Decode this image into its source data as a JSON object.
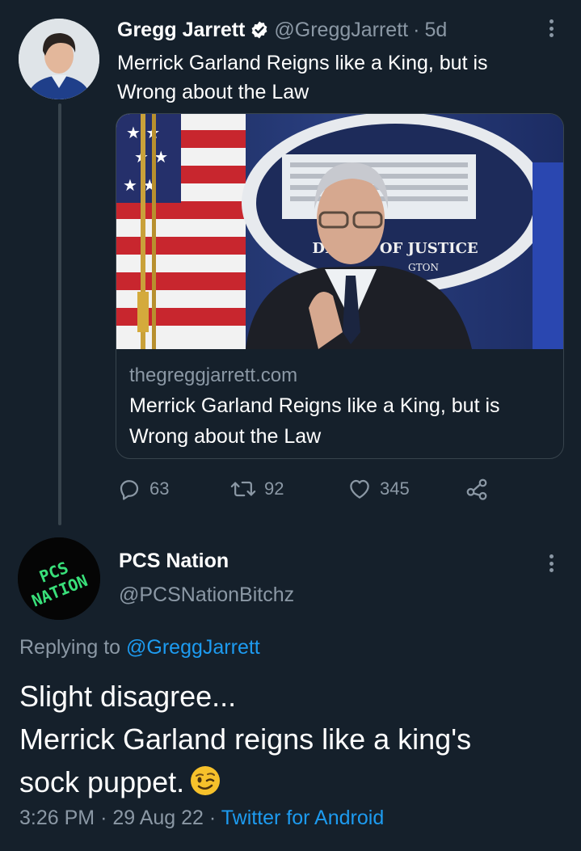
{
  "tweet1": {
    "display_name": "Gregg Jarrett",
    "handle": "@GreggJarrett",
    "separator": "·",
    "age": "5d",
    "text_line1": "Merrick Garland Reigns like a King, but is",
    "text_line2": "Wrong about the Law",
    "avatar_icon": "profile-photo",
    "card": {
      "domain": "thegreggjarrett.com",
      "title_line1": "Merrick Garland Reigns like a King, but is",
      "title_line2": "Wrong about the Law",
      "image_sign_text": "DE NT OF JUSTICE",
      "image_sign_subtext": "GTON"
    },
    "actions": {
      "replies": "63",
      "retweets": "92",
      "likes": "345"
    }
  },
  "tweet2": {
    "display_name": "PCS Nation",
    "handle": "@PCSNationBitchz",
    "avatar_logo_line1": "PCS",
    "avatar_logo_line2": "NATION",
    "replying_prefix": "Replying to",
    "replying_mention": "@GreggJarrett",
    "text_line1": "Slight disagree...",
    "text_line2": "Merrick Garland reigns like a king's",
    "text_line3": "sock puppet.",
    "emoji": "winking-face",
    "time": "3:26 PM",
    "date": "29 Aug 22",
    "separator": "·",
    "source": "Twitter for Android"
  },
  "colors": {
    "background": "#15202b",
    "secondary_text": "#8b98a5",
    "link": "#1d9bf0",
    "thread_line": "#38444d",
    "logo_green": "#39e07a"
  }
}
